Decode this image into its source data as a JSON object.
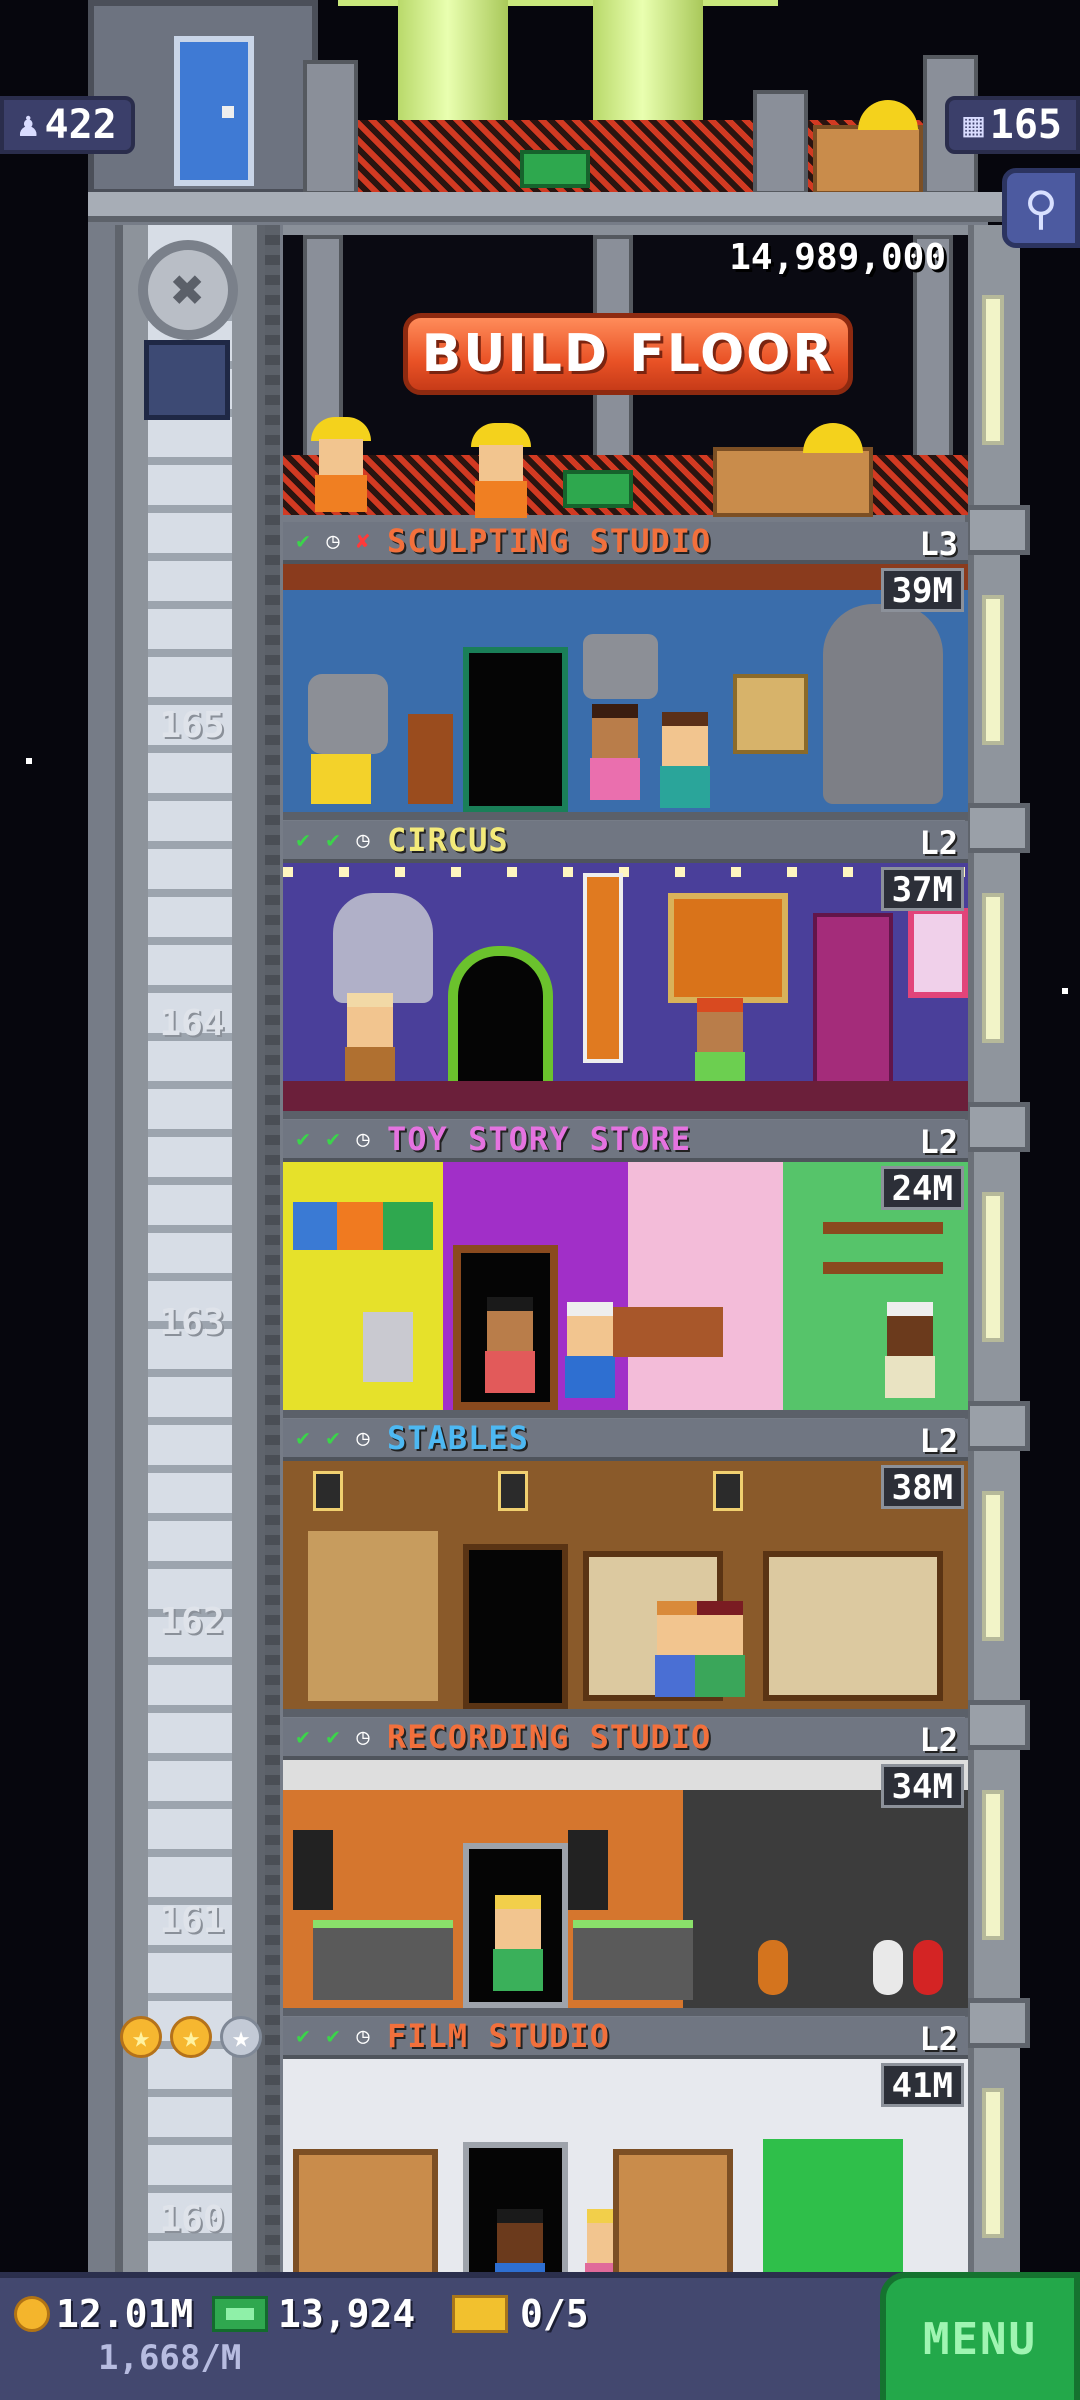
{
  "hud": {
    "population": "422",
    "population_icon": "person-icon",
    "floor_count": "165",
    "floor_count_icon": "building-icon",
    "search_icon": "magnifier-icon"
  },
  "build": {
    "cost": "14,989,000",
    "button_label": "BUILD FLOOR"
  },
  "floors": [
    {
      "number": "165",
      "name": "SCULPTING STUDIO",
      "level": "L3",
      "profit": "39M",
      "name_color": "#f2703c",
      "status": [
        "check",
        "clock",
        "x"
      ]
    },
    {
      "number": "164",
      "name": "CIRCUS",
      "level": "L2",
      "profit": "37M",
      "name_color": "#f3ea7a",
      "status": [
        "check",
        "check",
        "clock"
      ]
    },
    {
      "number": "163",
      "name": "TOY STORY STORE",
      "level": "L2",
      "profit": "24M",
      "name_color": "#e573e0",
      "status": [
        "check",
        "check",
        "clock"
      ]
    },
    {
      "number": "162",
      "name": "STABLES",
      "level": "L2",
      "profit": "38M",
      "name_color": "#4db8f2",
      "status": [
        "check",
        "check",
        "clock"
      ]
    },
    {
      "number": "161",
      "name": "RECORDING STUDIO",
      "level": "L2",
      "profit": "34M",
      "name_color": "#f2703c",
      "status": [
        "check",
        "check",
        "clock"
      ]
    },
    {
      "number": "160",
      "name": "FILM STUDIO",
      "level": "L2",
      "profit": "41M",
      "name_color": "#f2703c",
      "status": [
        "check",
        "check",
        "clock"
      ]
    }
  ],
  "elevator_rating": {
    "filled": 2,
    "total": 3
  },
  "bottom": {
    "coins": "12.01M",
    "income_rate": "1,668/M",
    "bux": "13,924",
    "tickets": "0/5",
    "menu_label": "MENU"
  },
  "colors": {
    "night_sky": "#06060d",
    "tower_gray": "#767c87",
    "menu_green": "#23a84a",
    "hud_purple": "#43486f"
  }
}
